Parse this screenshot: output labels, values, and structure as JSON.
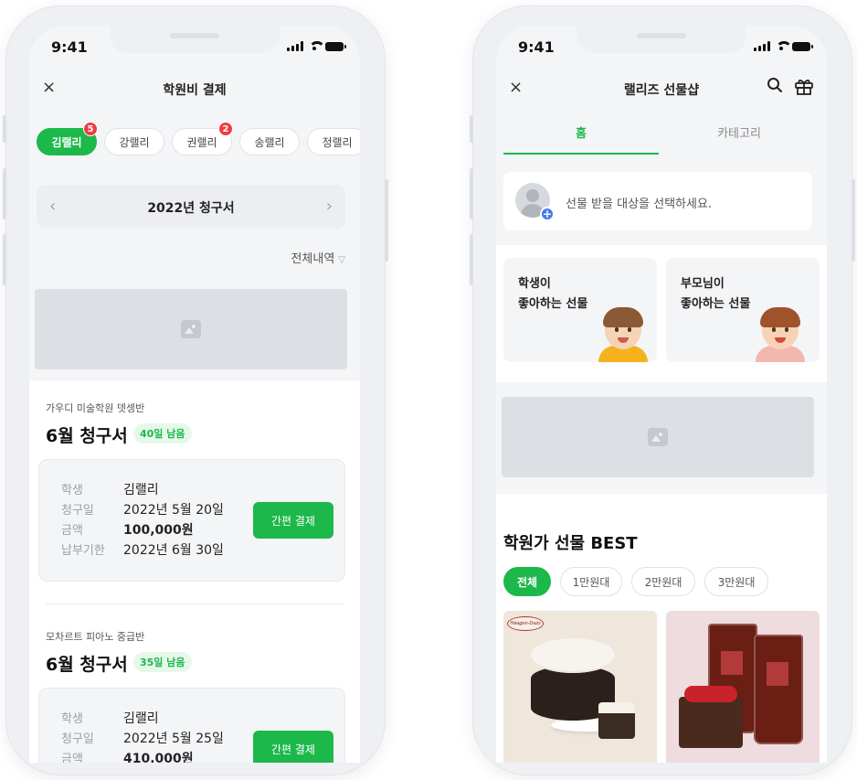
{
  "left": {
    "status": {
      "time": "9:41"
    },
    "nav": {
      "close": "×",
      "title": "학원비 결제"
    },
    "students": [
      {
        "name": "김랠리",
        "badge": "5",
        "active": true
      },
      {
        "name": "강랠리",
        "badge": "",
        "active": false
      },
      {
        "name": "권랠리",
        "badge": "2",
        "active": false
      },
      {
        "name": "송랠리",
        "badge": "",
        "active": false
      },
      {
        "name": "정랠리",
        "badge": "",
        "active": false
      }
    ],
    "year_nav": {
      "prev": "‹",
      "label": "2022년 청구서",
      "next": "›"
    },
    "all_history": "전체내역",
    "bills": [
      {
        "academy": "가우디 미술학원 뎃셍반",
        "title": "6월 청구서",
        "days_left": "40일 남음",
        "rows": [
          {
            "k": "학생",
            "v": "김랠리"
          },
          {
            "k": "청구일",
            "v": "2022년 5월 20일"
          },
          {
            "k": "금액",
            "v": "100,000원"
          },
          {
            "k": "납부기한",
            "v": "2022년 6월 30일"
          }
        ],
        "pay_label": "간편 결제"
      },
      {
        "academy": "모차르트 피아노 중급반",
        "title": "6월 청구서",
        "days_left": "35일 남음",
        "rows": [
          {
            "k": "학생",
            "v": "김랠리"
          },
          {
            "k": "청구일",
            "v": "2022년 5월 25일"
          },
          {
            "k": "금액",
            "v": "410,000원"
          }
        ],
        "pay_label": "간편 결제"
      }
    ]
  },
  "right": {
    "status": {
      "time": "9:41"
    },
    "nav": {
      "close": "×",
      "title": "랠리즈 선물샵"
    },
    "tabs": [
      "홈",
      "카테고리"
    ],
    "recipient_placeholder": "선물 받을 대상을 선택하세요.",
    "gift_cards": [
      {
        "line1": "학생이",
        "line2": "좋아하는 선물"
      },
      {
        "line1": "부모님이",
        "line2": "좋아하는 선물"
      }
    ],
    "best_title": "학원가 선물 BEST",
    "filters": [
      "전체",
      "1만원대",
      "2만원대",
      "3만원대"
    ],
    "product_logo": "Häagen-Dazs"
  },
  "colors": {
    "accent": "#1db84a",
    "badge": "#f03c43",
    "bg": "#f4f5f7"
  },
  "icons": [
    "close-icon",
    "chevron-down-icon",
    "image-icon",
    "search-icon",
    "gift-icon",
    "plus-icon"
  ]
}
